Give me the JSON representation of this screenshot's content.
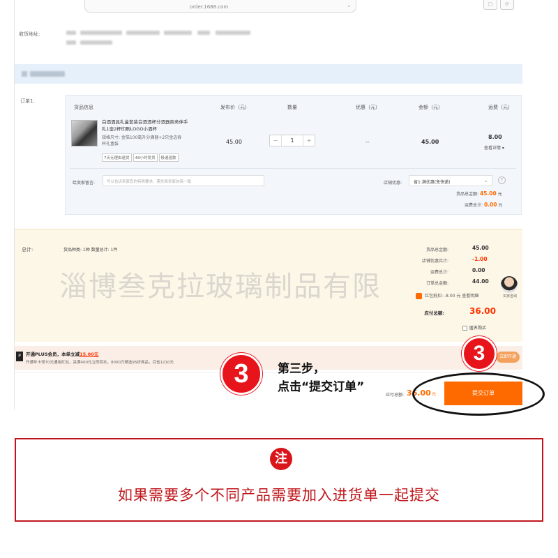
{
  "browser": {
    "url": "order.1688.com"
  },
  "address": {
    "label": "收货地址:"
  },
  "order": {
    "label": "订单1:",
    "headers": [
      "货品信息",
      "发布价（元）",
      "数量",
      "优惠（元）",
      "金额（元）",
      "运费（元）"
    ],
    "product": {
      "title": "白酒酒具礼盒套装白酒酒杯分酒器商务伴手礼1壶2杯印刷LOGO小酒杯",
      "spec": "规格尺寸: 金箔100毫升分酒器+2只金边吞杯礼盒装",
      "tags": [
        "7天无理由退货",
        "48小时发货",
        "极速退款"
      ],
      "price": "45.00",
      "quantity": "1",
      "discount": "--",
      "amount": "45.00",
      "freight": "8.00",
      "freight_link": "查看详情 ▾"
    },
    "message_label": "给卖家留言:",
    "message_placeholder": "可以告诉卖家您的特殊要求，需先和卖家协商一致",
    "shop_discount_label": "店铺优惠:",
    "shop_discount_value": "省1:满优惠(免快递)",
    "goods_total_label": "货品总金额:",
    "goods_total_value": "45.00",
    "freight_total_label": "运费总计:",
    "freight_total_value": "0.00",
    "unit": "元"
  },
  "summary": {
    "label": "总计:",
    "kinds": "货品种类: 1种  数量总计: 1件",
    "rows": [
      {
        "label": "货品总金额:",
        "value": "45.00"
      },
      {
        "label": "店铺优惠共计:",
        "value": "-1.00"
      },
      {
        "label": "运费总计:",
        "value": "0.00"
      },
      {
        "label": "订单总金额:",
        "value": "44.00"
      }
    ],
    "redpack": "红包抵扣: -8.00 元  查看明细",
    "payable_label": "应付总额:",
    "payable_value": "36.00",
    "unit": "元",
    "anonymous": "匿名购买",
    "side_caption": "买家咨询"
  },
  "watermark": "淄博叁克拉玻璃制品有限",
  "plus": {
    "logo": "P",
    "title_prefix": "开通PLUS会员，本单立减",
    "title_amount": "15.00元",
    "desc": "开通年卡领70元通用红包，采满400元立即回本，8000万精选95折商品，月省1210元",
    "button": "立即开通"
  },
  "bottom": {
    "pay_label": "应付总额:",
    "pay_value": "36.00",
    "pay_unit": "元",
    "submit": "提交订单"
  },
  "annotation": {
    "step_number": "3",
    "step_line1": "第三步，",
    "step_line2": "点击“提交订单”"
  },
  "note": {
    "icon": "注",
    "text": "如果需要多个不同产品需要加入进货单一起提交"
  }
}
